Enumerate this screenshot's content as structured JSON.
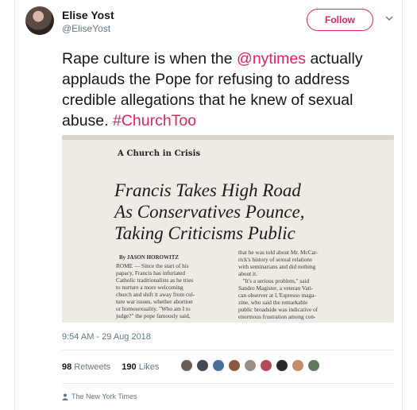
{
  "author": {
    "name": "Elise Yost",
    "handle": "@EliseYost",
    "follow_label": "Follow"
  },
  "tweet": {
    "text_part1": "Rape culture is when the ",
    "mention": "@nytimes",
    "text_part2": " actually applauds the Pope for refusing to address credible allegations that he knew of sexual abuse. ",
    "hashtag": "#ChurchToo"
  },
  "photo": {
    "kicker": "A Church in Crisis",
    "headline_lines": [
      "Francis Takes High Road",
      "As Conservatives Pounce,",
      "Taking Criticisms Public"
    ],
    "byline": "By JASON HOROWITZ",
    "left_col": "ROME — Since the start of his\npapacy, Francis has infuriated\nCatholic traditionalists as he tries\nto nurture a more welcoming\nchurch and shift it away from cul-\nture war issues, whether abortion\nor homosexuality. \"Who am I to\njudge?\" the pope famously said,",
    "right_col": "that he was told about Mr. McCar-\nrick's history of sexual relations\nwith seminarians and did nothing\nabout it.\n   \"It's a serious problem,\" said\nSandro Magister, a veteran Vati-\ncan observer at L'Espresso maga-\nzine, who said the remarkable\npublic broadside was indicative of\nenormous frustration among con-"
  },
  "meta": {
    "timestamp": "9:54 AM - 29 Aug 2018"
  },
  "stats": {
    "retweets_count": "98",
    "retweets_label": "Retweets",
    "likes_count": "190",
    "likes_label": "Likes"
  },
  "source": {
    "label": "The New York Times",
    "icon": "person-icon"
  },
  "colors": {
    "accent": "#e0245e",
    "secondary_text": "#657786"
  }
}
